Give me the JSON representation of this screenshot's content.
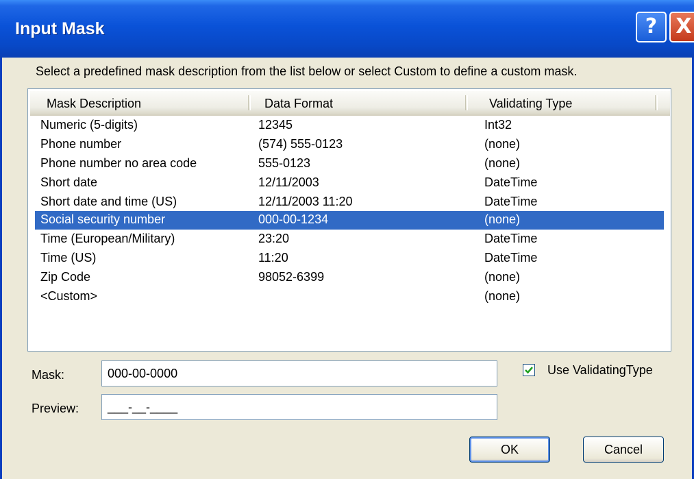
{
  "window": {
    "title": "Input Mask",
    "help_button": "?",
    "close_button": "X"
  },
  "instruction": "Select a predefined mask description from the list below or select Custom to define a custom mask.",
  "list": {
    "columns": [
      "Mask Description",
      "Data Format",
      "Validating Type"
    ],
    "rows": [
      {
        "description": "Numeric (5-digits)",
        "format": "12345",
        "type": "Int32"
      },
      {
        "description": "Phone number",
        "format": "(574) 555-0123",
        "type": "(none)"
      },
      {
        "description": "Phone number no area code",
        "format": "555-0123",
        "type": "(none)"
      },
      {
        "description": "Short date",
        "format": "12/11/2003",
        "type": "DateTime"
      },
      {
        "description": "Short date and time (US)",
        "format": "12/11/2003 11:20",
        "type": "DateTime"
      },
      {
        "description": "Social security number",
        "format": "000-00-1234",
        "type": "(none)"
      },
      {
        "description": "Time (European/Military)",
        "format": "23:20",
        "type": "DateTime"
      },
      {
        "description": "Time (US)",
        "format": "11:20",
        "type": "DateTime"
      },
      {
        "description": "Zip Code",
        "format": "98052-6399",
        "type": "(none)"
      },
      {
        "description": "<Custom>",
        "format": "",
        "type": "(none)"
      }
    ],
    "selected_index": 5
  },
  "mask": {
    "label": "Mask:",
    "value": "000-00-0000"
  },
  "preview": {
    "label": "Preview:",
    "value": "___-__-____"
  },
  "use_validating_type": {
    "label": "Use ValidatingType",
    "checked": true
  },
  "buttons": {
    "ok": "OK",
    "cancel": "Cancel"
  },
  "colors": {
    "selection": "#316ac5",
    "titlebar": "#0a52d8"
  }
}
